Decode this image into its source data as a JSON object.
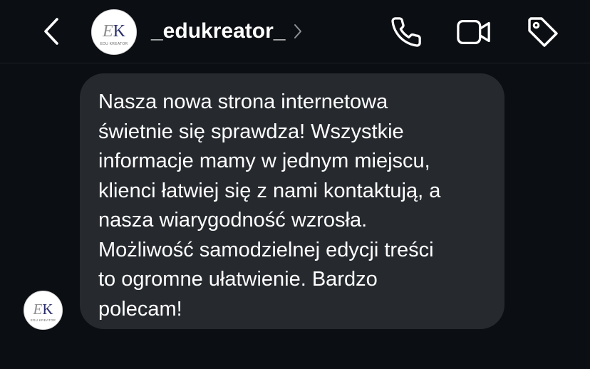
{
  "header": {
    "username": "_edukreator_",
    "chevron_icon": "chevron-right-icon",
    "back_icon": "chevron-left-icon",
    "call_icon": "phone-icon",
    "video_icon": "video-camera-icon",
    "tag_icon": "tag-icon"
  },
  "avatar": {
    "monogram_e": "E",
    "monogram_k": "K",
    "brand_text": "EDU KREATOR"
  },
  "message": {
    "lines": [
      "Nasza nowa strona internetowa",
      "świetnie się sprawdza! Wszystkie",
      "informacje mamy w jednym miejscu,",
      "klienci łatwiej się z nami kontaktują, a",
      "nasza wiarygodność wzrosła.",
      "Możliwość samodzielnej edycji treści",
      "to ogromne ułatwienie. Bardzo",
      "polecam!"
    ]
  },
  "colors": {
    "background": "#0b0e12",
    "bubble": "#262a2f",
    "text": "#ffffff",
    "monogram": "#2b2f6b"
  }
}
